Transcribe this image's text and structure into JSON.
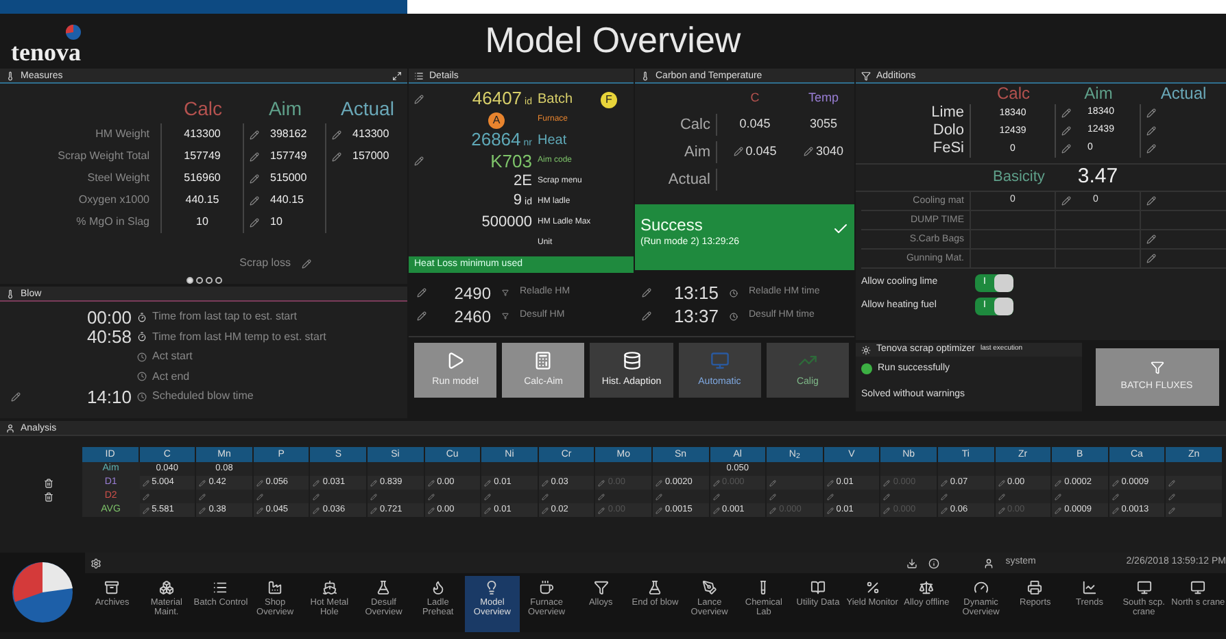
{
  "header": {
    "logo": "tenova",
    "title": "Model Overview"
  },
  "measures": {
    "title": "Measures",
    "columns": [
      "Calc",
      "Aim",
      "Actual"
    ],
    "rows": [
      {
        "label": "HM Weight",
        "calc": "413300",
        "aim": "398162",
        "actual": "413300"
      },
      {
        "label": "Scrap Weight Total",
        "calc": "157749",
        "aim": "157749",
        "actual": "157000"
      },
      {
        "label": "Steel Weight",
        "calc": "516960",
        "aim": "515000"
      },
      {
        "label": "Oxygen x1000",
        "calc": "440.15",
        "aim": "440.15"
      },
      {
        "label": "% MgO in Slag",
        "calc": "10",
        "aim": "10"
      }
    ],
    "scrap_loss": "Scrap loss",
    "pages": [
      {
        "selected": true
      },
      {
        "selected": false
      },
      {
        "selected": false
      },
      {
        "selected": false
      }
    ]
  },
  "blow": {
    "title": "Blow",
    "rows": [
      {
        "value": "00:00",
        "label": "Time from last tap to est. start",
        "edit": false
      },
      {
        "value": "40:58",
        "label": "Time from last HM temp to est. start",
        "edit": false
      },
      {
        "label": "Act start",
        "edit": false
      },
      {
        "label": "Act end",
        "edit": false
      },
      {
        "value": "14:10",
        "label": "Scheduled blow time",
        "edit": true
      }
    ]
  },
  "details": {
    "title": "Details",
    "rows": [
      {
        "value": "46407",
        "unit": "id",
        "label": "Batch",
        "badge": "F",
        "edit": true
      },
      {
        "label": "Furnace",
        "badge": "A",
        "edit": false
      },
      {
        "value": "26864",
        "unit": "nr",
        "label": "Heat",
        "edit": false
      },
      {
        "value": "K703",
        "label": "Aim code",
        "edit": true
      },
      {
        "value": "2E",
        "label": "Scrap menu",
        "edit": false
      },
      {
        "value": "9",
        "unit": "id",
        "label": "HM ladle",
        "edit": false
      },
      {
        "value": "500000",
        "label": "HM Ladle Max",
        "edit": false
      },
      {
        "label": "Unit",
        "edit": false
      }
    ],
    "notice": "Heat Loss minimum used"
  },
  "carbon": {
    "title": "Carbon and Temperature",
    "columns": [
      "C",
      "Temp"
    ],
    "rows": [
      {
        "label": "Calc",
        "c": "0.045",
        "temp": "3055",
        "edit": false
      },
      {
        "label": "Aim",
        "c": "0.045",
        "temp": "3040",
        "edit": true
      },
      {
        "label": "Actual",
        "edit": false
      }
    ]
  },
  "result": {
    "title": "Success",
    "detail": "(Run mode 2) 13:29:26"
  },
  "reladle": [
    {
      "value": "2490",
      "label": "Reladle HM",
      "time": "13:15",
      "time_label": "Reladle HM time"
    },
    {
      "value": "2460",
      "label": "Desulf HM",
      "time": "13:37",
      "time_label": "Desulf HM time"
    }
  ],
  "actions": [
    {
      "label": "Run model",
      "kind": "play",
      "disabled": false
    },
    {
      "label": "Calc-Aim",
      "kind": "calc",
      "disabled": false
    },
    {
      "label": "Hist. Adaption",
      "kind": "db",
      "disabled": false
    },
    {
      "label": "Automatic",
      "kind": "monitor",
      "disabled": true
    },
    {
      "label": "Calig",
      "kind": "chart",
      "disabled": true
    }
  ],
  "additions": {
    "title": "Additions",
    "columns": [
      "Calc",
      "Aim",
      "Actual"
    ],
    "rows": [
      {
        "label": "Lime",
        "calc": "18340",
        "aim": "18340"
      },
      {
        "label": "Dolo",
        "calc": "12439",
        "aim": "12439"
      },
      {
        "label": "FeSi",
        "calc": "0",
        "aim": "0"
      }
    ],
    "basicity_label": "Basicity",
    "basicity": "3.47",
    "materials": [
      {
        "label": "Cooling mat",
        "calc": "0",
        "aim": "0",
        "aim_edit": true,
        "actual_edit": true
      },
      {
        "label": "DUMP TIME",
        "aim_edit": false,
        "actual_edit": false
      },
      {
        "label": "S.Carb Bags",
        "aim_edit": false,
        "actual_edit": true
      },
      {
        "label": "Gunning Mat.",
        "aim_edit": false,
        "actual_edit": true
      }
    ],
    "toggles": [
      {
        "label": "Allow cooling lime",
        "on": true,
        "mark": "I"
      },
      {
        "label": "Allow heating fuel",
        "on": true,
        "mark": "I"
      }
    ]
  },
  "optimizer": {
    "title": "Tenova scrap optimizer",
    "note": "last execution",
    "status": "Run successfully",
    "ok": true,
    "message": "Solved without warnings",
    "button": "BATCH FLUXES"
  },
  "analysis": {
    "title": "Analysis",
    "columns": [
      "ID",
      "C",
      "Mn",
      "P",
      "S",
      "Si",
      "Cu",
      "Ni",
      "Cr",
      "Mo",
      "Sn",
      "Al",
      "N$_{2}$",
      "V",
      "Nb",
      "Ti",
      "Zr",
      "B",
      "Ca",
      "Zn"
    ],
    "rows": [
      {
        "color": "#5fb3b3",
        "deletable": false,
        "edit": false,
        "cells": [
          "Aim",
          "0.040",
          "0.08",
          "",
          "",
          "",
          "",
          "",
          "",
          "",
          "",
          "0.050",
          "",
          "",
          "",
          "",
          "",
          "",
          "",
          ""
        ]
      },
      {
        "color": "#9a7fd6",
        "deletable": true,
        "edit": true,
        "cells": [
          "D1",
          "5.004",
          "0.42",
          "0.056",
          "0.031",
          "0.839",
          "0.00",
          "0.01",
          "0.03",
          {
            "text": "0.00",
            "dim": true
          },
          "0.0020",
          {
            "text": "0.000",
            "dim": true
          },
          "",
          "0.01",
          {
            "text": "0.000",
            "dim": true
          },
          "0.07",
          "0.00",
          "0.0002",
          "0.0009",
          ""
        ]
      },
      {
        "color": "#d0504a",
        "deletable": true,
        "edit": true,
        "cells": [
          "D2",
          "",
          "",
          "",
          "",
          "",
          "",
          "",
          "",
          "",
          "",
          "",
          "",
          "",
          "",
          "",
          "",
          "",
          "",
          ""
        ]
      },
      {
        "color": "#7ec46a",
        "deletable": false,
        "edit": true,
        "cells": [
          "AVG",
          "5.581",
          "0.38",
          "0.045",
          "0.036",
          "0.721",
          "0.00",
          "0.01",
          "0.02",
          {
            "text": "0.00",
            "dim": true
          },
          "0.0015",
          "0.001",
          {
            "text": "0.000",
            "dim": true
          },
          "0.01",
          {
            "text": "0.000",
            "dim": true
          },
          "0.06",
          {
            "text": "0.00",
            "dim": true
          },
          "0.0009",
          "0.0013",
          ""
        ]
      }
    ]
  },
  "footer": {
    "user": "system",
    "datetime": "2/26/2018 13:59:12 PM",
    "nav": [
      {
        "label": "Archives",
        "selected": false
      },
      {
        "label": "Material Maint.",
        "selected": false
      },
      {
        "label": "Batch Control",
        "selected": false
      },
      {
        "label": "Shop Overview",
        "selected": false
      },
      {
        "label": "Hot Metal Hole",
        "selected": false
      },
      {
        "label": "Desulf Overview",
        "selected": false
      },
      {
        "label": "Ladle Preheat",
        "selected": false
      },
      {
        "label": "Model Overview",
        "selected": true
      },
      {
        "label": "Furnace Overview",
        "selected": false
      },
      {
        "label": "Alloys",
        "selected": false
      },
      {
        "label": "End of blow",
        "selected": false
      },
      {
        "label": "Lance Overview",
        "selected": false
      },
      {
        "label": "Chemical Lab",
        "selected": false
      },
      {
        "label": "Utility Data",
        "selected": false
      },
      {
        "label": "Yield Monitor",
        "selected": false
      },
      {
        "label": "Alloy offline",
        "selected": false
      },
      {
        "label": "Dynamic Overview",
        "selected": false
      },
      {
        "label": "Reports",
        "selected": false
      },
      {
        "label": "Trends",
        "selected": false
      },
      {
        "label": "South scp. crane",
        "selected": false
      },
      {
        "label": "North s crane",
        "selected": false
      }
    ]
  }
}
